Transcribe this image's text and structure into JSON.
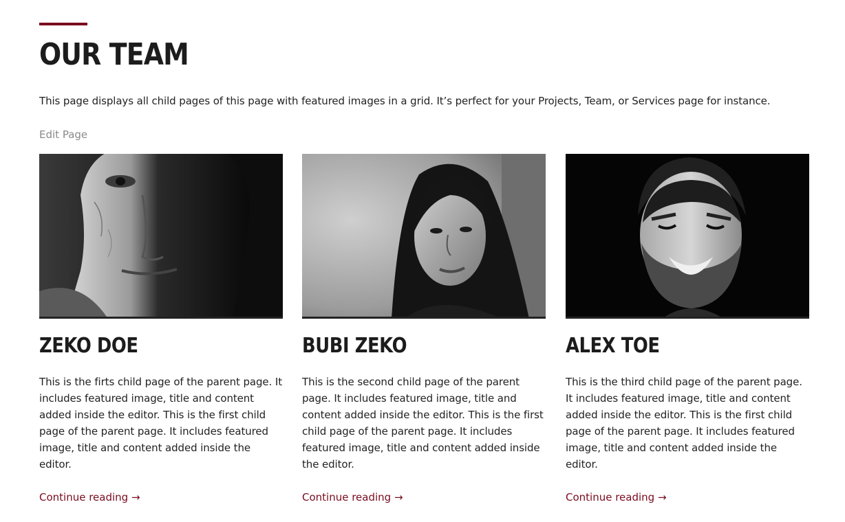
{
  "page": {
    "title": "OUR TEAM",
    "intro": "This page displays all child pages of this page with featured images in a grid. It’s perfect for your Projects, Team, or Services page for instance.",
    "edit_link": "Edit Page"
  },
  "colors": {
    "accent": "#7a0b1e",
    "heading": "#1c1c1c",
    "muted_link": "#8a8a8a"
  },
  "team": [
    {
      "name": "ZEKO DOE",
      "description": "This is the firts child page of the parent page. It includes featured image, title and content added inside the editor. This is the first child page of the parent page. It includes featured image, title and content added inside the editor.",
      "link": "Continue reading →",
      "photo": "black-and-white portrait of an older man, half face in shadow"
    },
    {
      "name": "BUBI ZEKO",
      "description": "This is the second child page of the parent page. It includes featured image, title and content added inside the editor. This is the first child page of the parent page. It includes featured image, title and content added inside the editor.",
      "link": "Continue reading →",
      "photo": "black-and-white portrait of a young woman with long dark hair"
    },
    {
      "name": "ALEX TOE",
      "description": "This is the third child page of the parent page. It includes featured image, title and content added inside the editor. This is the first child page of the parent page. It includes featured image, title and content added inside the editor.",
      "link": "Continue reading →",
      "photo": "black-and-white portrait of a smiling bearded man"
    }
  ]
}
